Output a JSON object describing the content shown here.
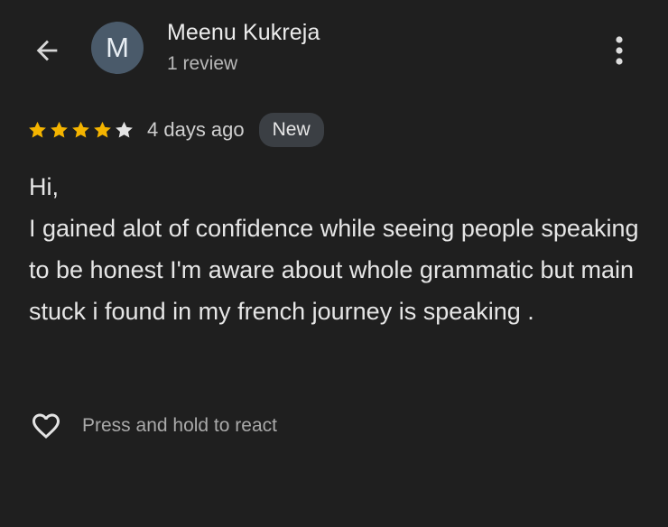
{
  "header": {
    "back_icon": "arrow-left-icon",
    "avatar_letter": "M",
    "author_name": "Meenu Kukreja",
    "author_meta": "1 review",
    "more_icon": "more-vert-icon"
  },
  "review": {
    "rating": 4,
    "rating_max": 5,
    "star_color": "#f4b400",
    "empty_star_color": "#e3e3e3",
    "date": "4 days ago",
    "badge": "New",
    "text": "Hi,\nI gained alot of confidence while seeing people speaking to be honest I'm aware about whole grammatic but main stuck i found in my french journey is speaking ."
  },
  "actions": {
    "react_icon": "heart-outline-icon",
    "react_label": "Press and hold to react"
  },
  "colors": {
    "background": "#1f1f1f",
    "avatar_bg": "#4a5a6a",
    "badge_bg": "#3b3f44"
  }
}
